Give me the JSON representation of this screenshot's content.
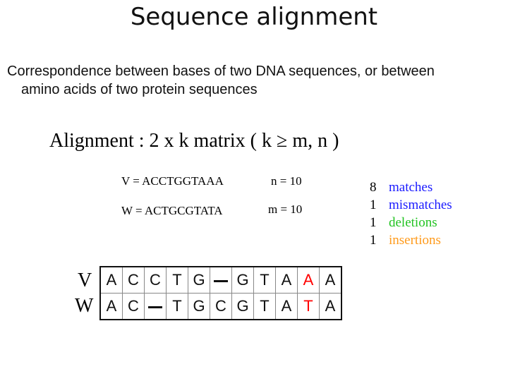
{
  "title": "Sequence alignment",
  "description": {
    "line1": "Correspondence between bases of two DNA sequences, or between",
    "line2": "amino acids of two protein sequences"
  },
  "alignment_definition": "Alignment :  2 x k matrix ( k ≥ m, n )",
  "sequences": {
    "v": {
      "label": "V  = ACCTGGTAAA",
      "length": "n = 10"
    },
    "w": {
      "label": "W = ACTGCGTATA",
      "length": "m = 10"
    }
  },
  "stats": [
    {
      "count": "8",
      "label": "matches",
      "color": "#1a1aff"
    },
    {
      "count": "1",
      "label": "mismatches",
      "color": "#1a1aff"
    },
    {
      "count": "1",
      "label": "deletions",
      "color": "#22c322"
    },
    {
      "count": "1",
      "label": "insertions",
      "color": "#ff9a1a"
    }
  ],
  "alignment_matrix": {
    "row_labels": [
      "V",
      "W"
    ],
    "rows": [
      [
        "A",
        "C",
        "C",
        "T",
        "G",
        "-",
        "G",
        "T",
        "A",
        "A",
        "A"
      ],
      [
        "A",
        "C",
        "-",
        "T",
        "G",
        "C",
        "G",
        "T",
        "A",
        "T",
        "A"
      ]
    ],
    "mismatch_column": 9,
    "mismatch_color": "#ff0000"
  }
}
